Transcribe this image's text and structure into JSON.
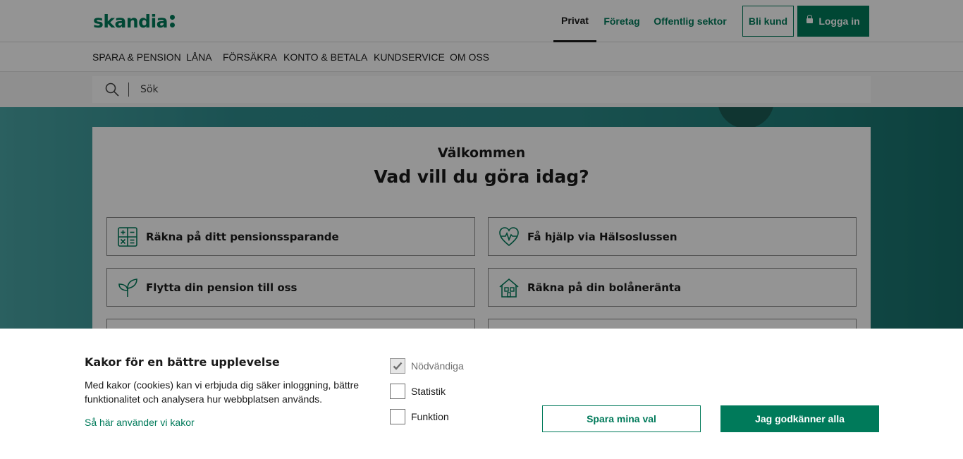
{
  "header": {
    "logo": "skandia",
    "segments": [
      "Privat",
      "Företag",
      "Offentlig sektor"
    ],
    "active_segment": "Privat",
    "bli_kund": "Bli kund",
    "logga_in": "Logga in"
  },
  "nav": {
    "items": [
      "SPARA & PENSION",
      "LÅNA",
      "FÖRSÄKRA",
      "KONTO & BETALA",
      "KUNDSERVICE",
      "OM OSS"
    ]
  },
  "search": {
    "placeholder": "Sök"
  },
  "hero": {
    "kicker": "Välkommen",
    "title": "Vad vill du göra idag?",
    "actions": [
      {
        "label": "Räkna på ditt pensionssparande",
        "icon": "calculator-icon"
      },
      {
        "label": "Få hjälp via Hälsoslussen",
        "icon": "heart-pulse-icon"
      },
      {
        "label": "Flytta din pension till oss",
        "icon": "sprout-icon"
      },
      {
        "label": "Räkna på din bolåneränta",
        "icon": "house-icon"
      }
    ]
  },
  "cookie": {
    "title": "Kakor för en bättre upplevelse",
    "text": "Med kakor (cookies) kan vi erbjuda dig säker inloggning, bättre funktionalitet och analysera hur webbplatsen används.",
    "link": "Så här använder vi kakor",
    "options": [
      {
        "label": "Nödvändiga",
        "checked": true,
        "disabled": true
      },
      {
        "label": "Statistik",
        "checked": false,
        "disabled": false
      },
      {
        "label": "Funktion",
        "checked": false,
        "disabled": false
      }
    ],
    "save_button": "Spara mina val",
    "accept_button": "Jag godkänner alla"
  },
  "colors": {
    "brand": "#007a5a",
    "hero": "#2b8a88"
  }
}
